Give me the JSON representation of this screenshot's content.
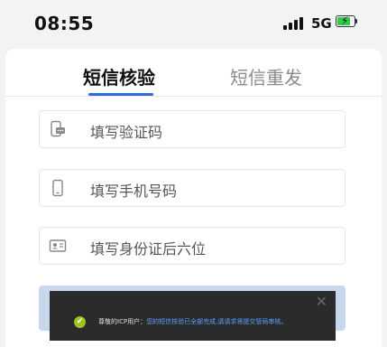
{
  "status_bar": {
    "time": "08:55",
    "network": "5G",
    "battery_percent": 80,
    "charging": true
  },
  "tabs": [
    {
      "label": "短信核验",
      "active": true
    },
    {
      "label": "短信重发",
      "active": false
    }
  ],
  "form": {
    "fields": [
      {
        "icon": "sms-phone-icon",
        "placeholder": "填写验证码"
      },
      {
        "icon": "mobile-phone-icon",
        "placeholder": "填写手机号码"
      },
      {
        "icon": "id-card-icon",
        "placeholder": "填写身份证后六位"
      }
    ]
  },
  "toast": {
    "lead": "尊敬的ICP用户：",
    "message": "您的短信核验已全部完成,请请求将提交管局审核。",
    "close": "✕",
    "ok_glyph": "✔"
  },
  "colors": {
    "accent": "#2d6cdf",
    "button_disabled": "#c9d7ee",
    "success": "#9cc51f",
    "toast_bg": "#2b2b2b"
  }
}
